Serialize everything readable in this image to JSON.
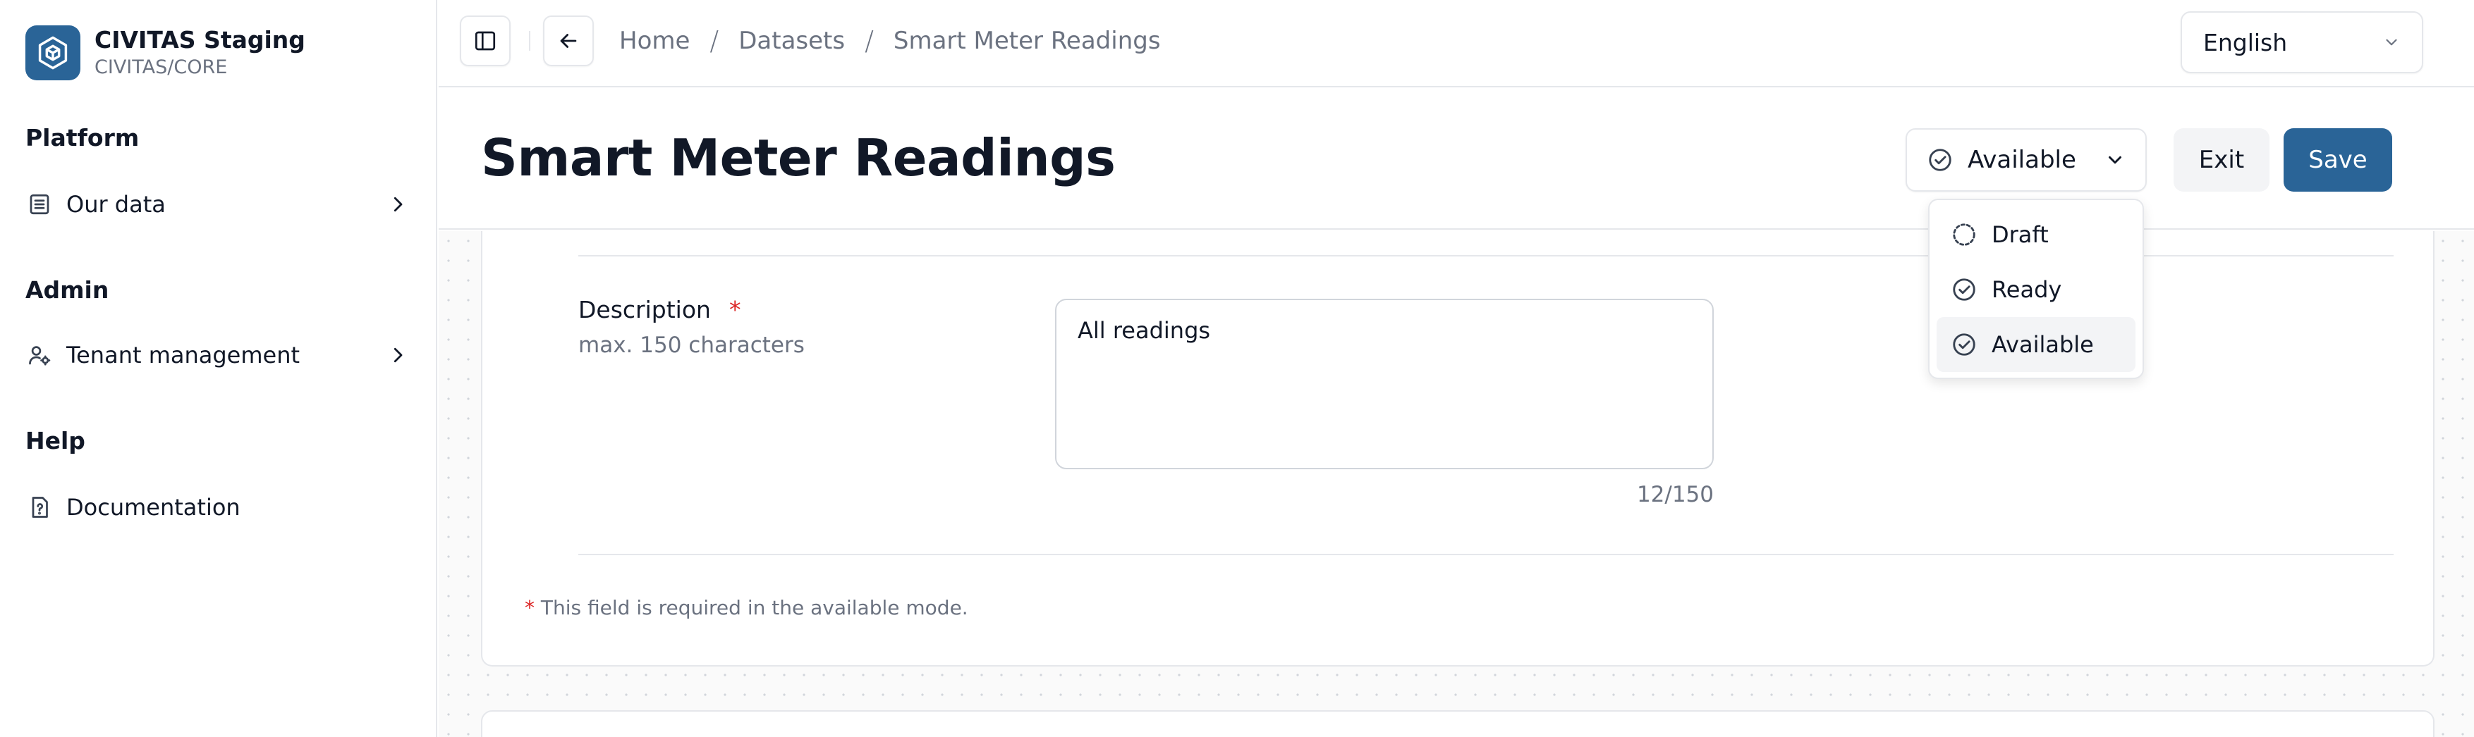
{
  "sidebar": {
    "brand": {
      "title": "CIVITAS Staging",
      "subtitle": "CIVITAS/CORE",
      "logo_icon": "hexagon-cube-icon"
    },
    "sections": [
      {
        "label": "Platform",
        "items": [
          {
            "label": "Our data",
            "icon": "list-icon"
          }
        ]
      },
      {
        "label": "Admin",
        "items": [
          {
            "label": "Tenant management",
            "icon": "user-cog-icon"
          }
        ]
      },
      {
        "label": "Help",
        "items": [
          {
            "label": "Documentation",
            "icon": "file-question-icon"
          }
        ]
      }
    ]
  },
  "topbar": {
    "breadcrumb": [
      "Home",
      "Datasets",
      "Smart Meter Readings"
    ],
    "language": "English"
  },
  "header": {
    "title": "Smart Meter Readings",
    "status": "Available",
    "exit_label": "Exit",
    "save_label": "Save"
  },
  "status_menu": {
    "options": [
      {
        "label": "Draft",
        "icon": "circle-dashed-icon"
      },
      {
        "label": "Ready",
        "icon": "circle-check-icon"
      },
      {
        "label": "Available",
        "icon": "circle-check-icon",
        "selected": true
      }
    ]
  },
  "form": {
    "description_label": "Description",
    "required_marker": "*",
    "description_hint": "max. 150 characters",
    "description_value": "All readings",
    "counter": "12/150",
    "required_note": "This field is required in the available mode."
  },
  "colors": {
    "accent": "#2a6497",
    "required": "#dc2626"
  }
}
